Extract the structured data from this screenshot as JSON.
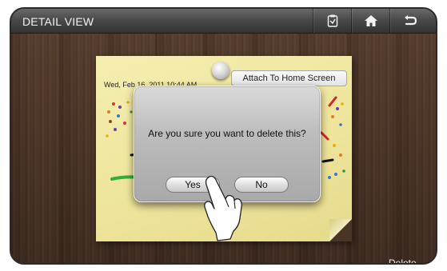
{
  "header": {
    "title": "DETAIL VIEW",
    "buttons": [
      {
        "name": "edit-note-icon"
      },
      {
        "name": "home-icon"
      },
      {
        "name": "back-icon"
      }
    ]
  },
  "note": {
    "date": "Wed, Feb 16, 2011 10:44 AM",
    "attach_label": "Attach To Home Screen"
  },
  "dialog": {
    "message": "Are you sure you want to delete this?",
    "yes_label": "Yes",
    "no_label": "No"
  },
  "footer": {
    "delete_label": "Delete"
  },
  "colors": {
    "wood": "#4c3527",
    "note": "#f0e6a0",
    "titlebar": "#444444"
  }
}
